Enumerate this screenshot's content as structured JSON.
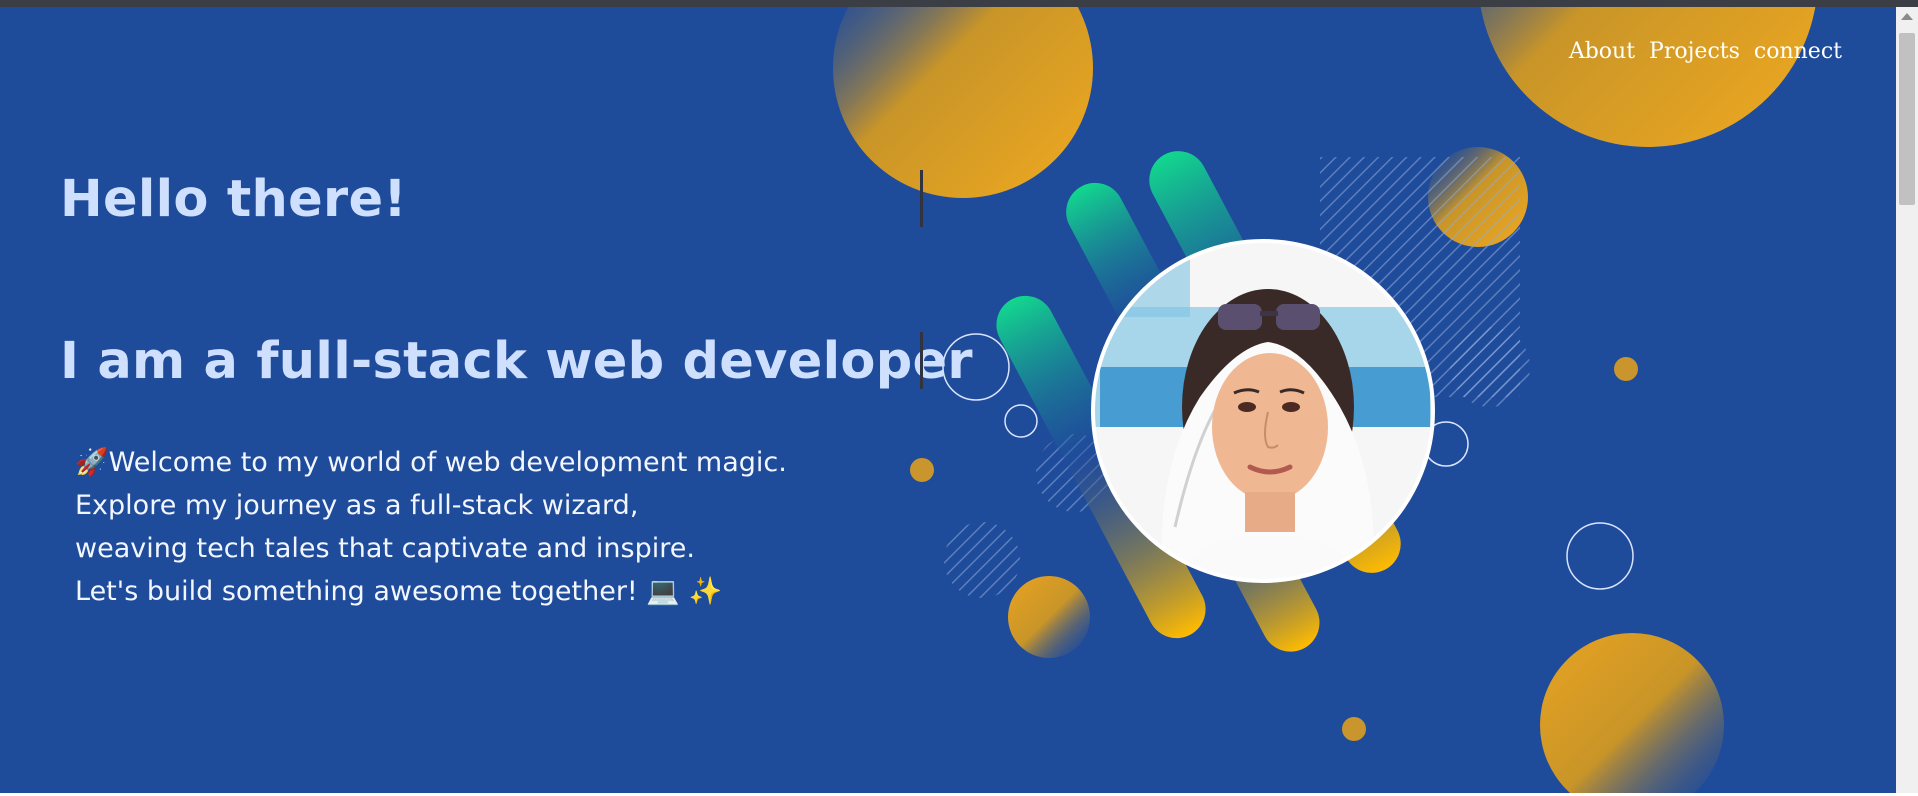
{
  "nav": {
    "items": [
      {
        "label": "About"
      },
      {
        "label": "Projects"
      },
      {
        "label": "connect"
      }
    ]
  },
  "hero": {
    "greeting": "Hello there!",
    "role": "I am a full-stack web developer",
    "intro_lines": [
      "🚀Welcome to my world of web development magic.",
      "Explore my journey as a full-stack wizard,",
      "weaving tech tales that captivate and inspire.",
      "Let's build something awesome together! 💻 ✨"
    ]
  },
  "colors": {
    "background": "#1f4b9b",
    "heading": "#cfe0ff",
    "accent_gold": "#f5b800",
    "accent_green": "#10d38b"
  }
}
